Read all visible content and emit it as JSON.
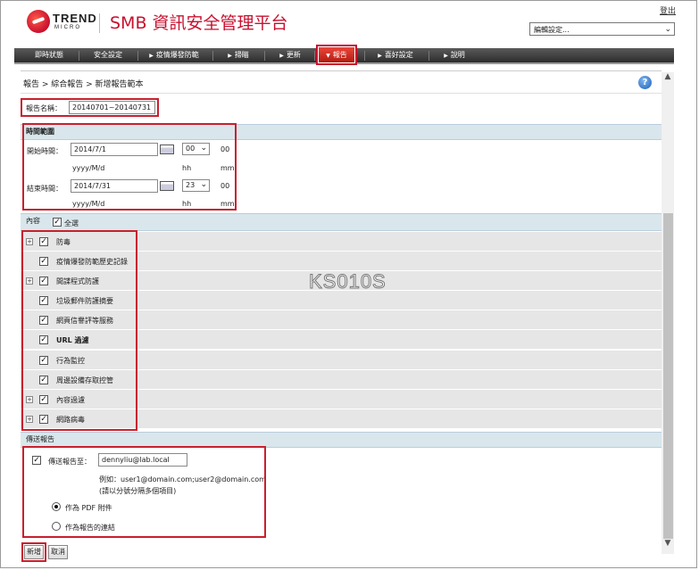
{
  "header": {
    "brand_top": "TREND",
    "brand_bottom": "MICRO",
    "app_title": "SMB 資訊安全管理平台",
    "logout": "登出",
    "edit_settings": "編輯設定..."
  },
  "nav": {
    "items": [
      {
        "label": "即時狀態",
        "arrow": false
      },
      {
        "label": "安全設定",
        "arrow": false
      },
      {
        "label": "疫情爆發防範",
        "arrow": true
      },
      {
        "label": "掃瞄",
        "arrow": true
      },
      {
        "label": "更新",
        "arrow": true
      },
      {
        "label": "報告",
        "arrow": true
      },
      {
        "label": "喜好設定",
        "arrow": true
      },
      {
        "label": "說明",
        "arrow": true
      }
    ]
  },
  "breadcrumb": "報告 > 綜合報告 > 新增報告範本",
  "report_name": {
    "label": "報告名稱：",
    "value": "20140701~20140731"
  },
  "time_range": {
    "title": "時間範圍",
    "start_label": "開始時間：",
    "start_date": "2014/7/1",
    "start_hour": "00",
    "start_min": "00",
    "end_label": "結束時間：",
    "end_date": "2014/7/31",
    "end_hour": "23",
    "end_min": "00",
    "date_hint": "yyyy/M/d",
    "hour_hint": "hh",
    "min_hint": "mm"
  },
  "content": {
    "title": "內容",
    "select_all": "全選",
    "items": [
      {
        "label": "防毒",
        "expandable": true,
        "bold": false
      },
      {
        "label": "疫情爆發防範歷史記錄",
        "expandable": false,
        "bold": false
      },
      {
        "label": "間諜程式防護",
        "expandable": true,
        "bold": false
      },
      {
        "label": "垃圾郵件防護摘要",
        "expandable": false,
        "bold": false
      },
      {
        "label": "網頁信譽評等服務",
        "expandable": false,
        "bold": false
      },
      {
        "label": "URL 過濾",
        "expandable": false,
        "bold": true
      },
      {
        "label": "行為監控",
        "expandable": false,
        "bold": false
      },
      {
        "label": "周邊設備存取控管",
        "expandable": false,
        "bold": false
      },
      {
        "label": "內容過濾",
        "expandable": true,
        "bold": false
      },
      {
        "label": "網路病毒",
        "expandable": true,
        "bold": false
      }
    ]
  },
  "send_report": {
    "title": "傳送報告",
    "send_to_label": "傳送報告至：",
    "email": "dennyliu@lab.local",
    "example": "例如：user1@domain.com;user2@domain.com",
    "hint": "(請以分號分隔多個項目)",
    "option_pdf": "作為 PDF 附件",
    "option_link": "作為報告的連結"
  },
  "watermark": "KS010S",
  "buttons": {
    "add": "新增",
    "cancel": "取消"
  }
}
